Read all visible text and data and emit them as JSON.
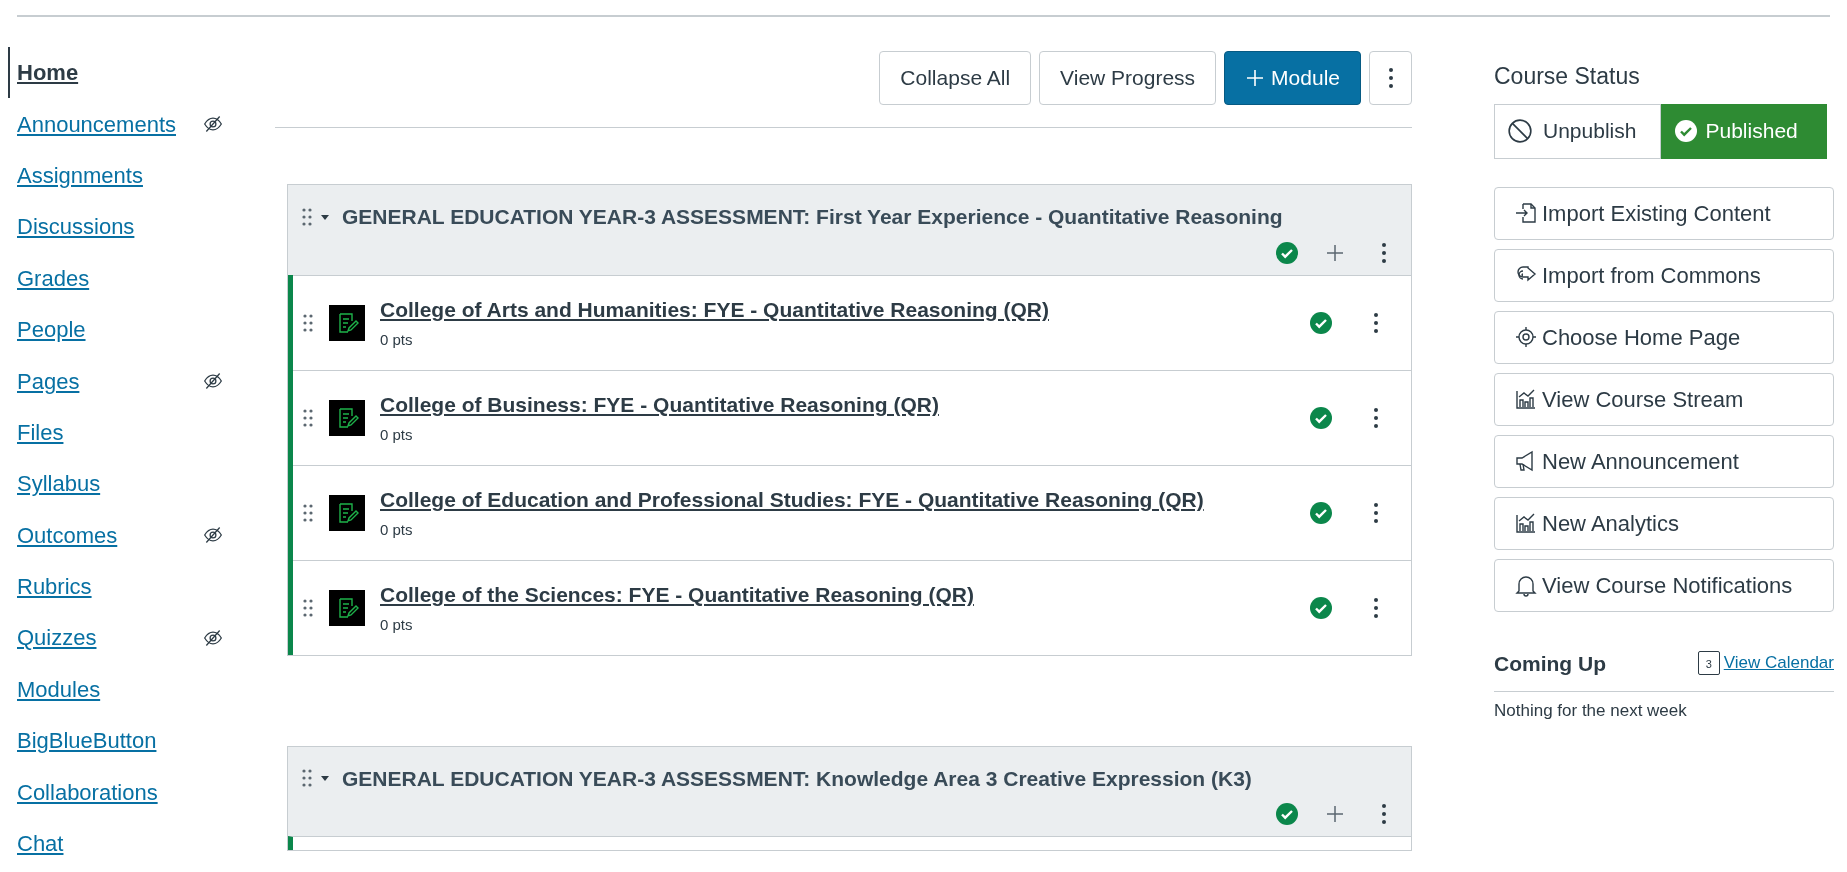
{
  "nav": [
    {
      "label": "Home",
      "selected": true,
      "hidden": false
    },
    {
      "label": "Announcements",
      "selected": false,
      "hidden": true
    },
    {
      "label": "Assignments",
      "selected": false,
      "hidden": false
    },
    {
      "label": "Discussions",
      "selected": false,
      "hidden": false
    },
    {
      "label": "Grades",
      "selected": false,
      "hidden": false
    },
    {
      "label": "People",
      "selected": false,
      "hidden": false
    },
    {
      "label": "Pages",
      "selected": false,
      "hidden": true
    },
    {
      "label": "Files",
      "selected": false,
      "hidden": false
    },
    {
      "label": "Syllabus",
      "selected": false,
      "hidden": false
    },
    {
      "label": "Outcomes",
      "selected": false,
      "hidden": true
    },
    {
      "label": "Rubrics",
      "selected": false,
      "hidden": false
    },
    {
      "label": "Quizzes",
      "selected": false,
      "hidden": true
    },
    {
      "label": "Modules",
      "selected": false,
      "hidden": false
    },
    {
      "label": "BigBlueButton",
      "selected": false,
      "hidden": false
    },
    {
      "label": "Collaborations",
      "selected": false,
      "hidden": false
    },
    {
      "label": "Chat",
      "selected": false,
      "hidden": false
    }
  ],
  "toolbar": {
    "buttons": [
      "Collapse All",
      "View Progress"
    ],
    "primary": "Module"
  },
  "modules": [
    {
      "title": "GENERAL EDUCATION YEAR-3 ASSESSMENT: First Year Experience - Quantitative Reasoning",
      "published": true,
      "items": [
        {
          "title": "College of Arts and Humanities: FYE - Quantitative Reasoning (QR)",
          "points": "0 pts",
          "published": true
        },
        {
          "title": "College of Business: FYE - Quantitative Reasoning (QR)",
          "points": "0 pts",
          "published": true
        },
        {
          "title": "College of Education and Professional Studies: FYE - Quantitative Reasoning (QR)",
          "points": "0 pts",
          "published": true
        },
        {
          "title": "College of the Sciences: FYE - Quantitative Reasoning (QR)",
          "points": "0 pts",
          "published": true
        }
      ]
    },
    {
      "title": "GENERAL EDUCATION YEAR-3 ASSESSMENT: Knowledge Area 3 Creative Expression (K3)",
      "published": true
    }
  ],
  "course_status": {
    "title": "Course Status",
    "options": [
      {
        "label": "Unpublish",
        "selected": false
      },
      {
        "label": "Published",
        "selected": true
      }
    ]
  },
  "actions": [
    {
      "kind": "import",
      "label": "Import Existing Content"
    },
    {
      "kind": "commons",
      "label": "Import from Commons"
    },
    {
      "kind": "home",
      "label": "Choose Home Page"
    },
    {
      "kind": "chart",
      "label": "View Course Stream"
    },
    {
      "kind": "megaphone",
      "label": "New Announcement"
    },
    {
      "kind": "chart",
      "label": "New Analytics"
    },
    {
      "kind": "bell",
      "label": "View Course Notifications"
    }
  ],
  "coming_up": {
    "title": "Coming Up",
    "calendar_day": "3",
    "link": "View Calendar",
    "empty": "Nothing for the next week"
  }
}
